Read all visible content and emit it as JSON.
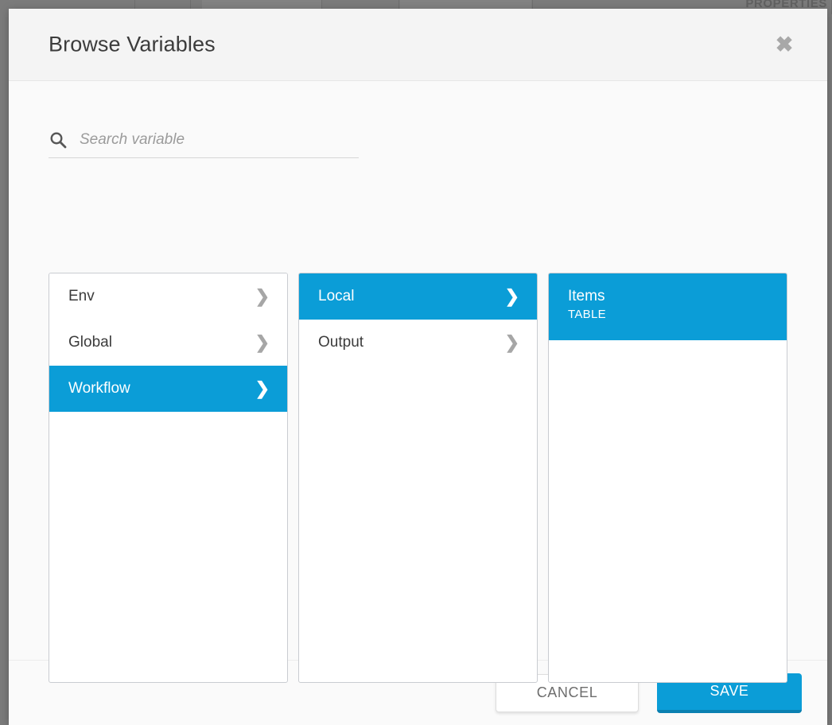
{
  "backdrop": {
    "panel_title": "PROPERTIES",
    "overlay_color": "#7b7b7b"
  },
  "modal": {
    "title": "Browse Variables",
    "close_icon": "close-icon",
    "close_label": "✖"
  },
  "search": {
    "icon": "search-icon",
    "value": "",
    "placeholder": "Search variable"
  },
  "columns": [
    {
      "name": "variable-scope-column",
      "items": [
        {
          "label": "Env",
          "sublabel": "",
          "selected": false,
          "chevron": "❯"
        },
        {
          "label": "Global",
          "sublabel": "",
          "selected": false,
          "chevron": "❯"
        },
        {
          "label": "Workflow",
          "sublabel": "",
          "selected": true,
          "chevron": "❯"
        }
      ]
    },
    {
      "name": "variable-group-column",
      "items": [
        {
          "label": "Local",
          "sublabel": "",
          "selected": true,
          "chevron": "❯"
        },
        {
          "label": "Output",
          "sublabel": "",
          "selected": false,
          "chevron": "❯"
        }
      ]
    },
    {
      "name": "variable-detail-column",
      "items": [
        {
          "label": "Items",
          "sublabel": "TABLE",
          "selected": true,
          "chevron": ""
        }
      ]
    }
  ],
  "footer": {
    "cancel_label": "CANCEL",
    "save_label": "SAVE"
  },
  "colors": {
    "accent": "#0b9dd7",
    "accent_dark": "#0a80b1",
    "header_bg": "#f4f4f4",
    "body_bg": "#fafafa",
    "text": "#3c3c3c",
    "muted": "#9b9b9b"
  }
}
